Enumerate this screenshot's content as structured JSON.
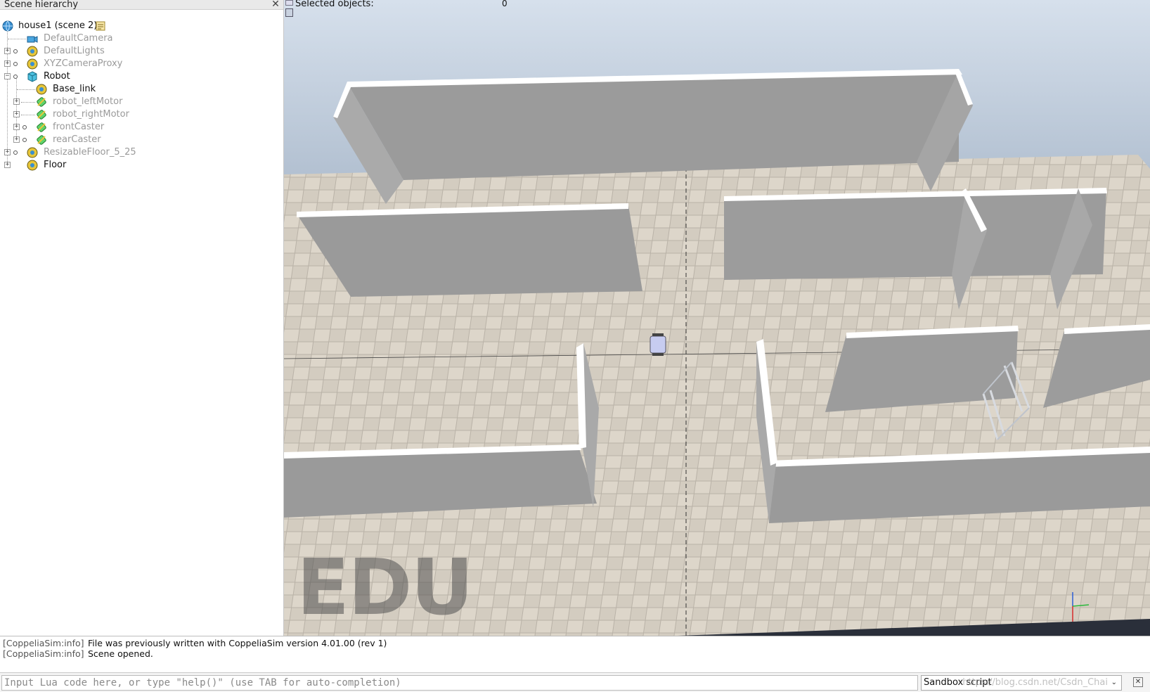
{
  "hierarchy": {
    "title": "Scene hierarchy",
    "close_icon": "close-icon",
    "items": [
      {
        "label": "house1 (scene 2)",
        "icon": "globe-icon",
        "style": "dark"
      },
      {
        "label": "DefaultCamera",
        "icon": "camera-icon",
        "style": "gray"
      },
      {
        "label": "DefaultLights",
        "icon": "dummy-icon",
        "style": "gray"
      },
      {
        "label": "XYZCameraProxy",
        "icon": "dummy-icon",
        "style": "gray"
      },
      {
        "label": "Robot",
        "icon": "cube-icon",
        "style": "dark"
      },
      {
        "label": "Base_link",
        "icon": "dummy-icon",
        "style": "dark"
      },
      {
        "label": "robot_leftMotor",
        "icon": "joint-icon",
        "style": "gray"
      },
      {
        "label": "robot_rightMotor",
        "icon": "joint-icon",
        "style": "gray"
      },
      {
        "label": "frontCaster",
        "icon": "joint-icon",
        "style": "gray"
      },
      {
        "label": "rearCaster",
        "icon": "joint-icon",
        "style": "gray"
      },
      {
        "label": "ResizableFloor_5_25",
        "icon": "dummy-icon",
        "style": "gray"
      },
      {
        "label": "Floor",
        "icon": "dummy-icon",
        "style": "dark"
      }
    ]
  },
  "viewport": {
    "selected_label": "Selected objects:",
    "selected_count": "0",
    "watermark": "EDU"
  },
  "console": {
    "lines": [
      {
        "tag": "[CoppeliaSim:info]",
        "text": "File was previously written with CoppeliaSim version 4.01.00 (rev 1)"
      },
      {
        "tag": "[CoppeliaSim:info]",
        "text": "Scene opened."
      }
    ]
  },
  "lua": {
    "placeholder": "Input Lua code here, or type \"help()\" (use TAB for auto-completion)",
    "script_selected": "Sandbox script",
    "watermark": "https://blog.csdn.net/Csdn_Chai"
  },
  "colors": {
    "wall": "#9b9b9b",
    "wall_top": "#ffffff",
    "floor_tile_a": "#ddd6ca",
    "floor_tile_b": "#cfc8bc",
    "sky_top": "#d6e0ec"
  }
}
